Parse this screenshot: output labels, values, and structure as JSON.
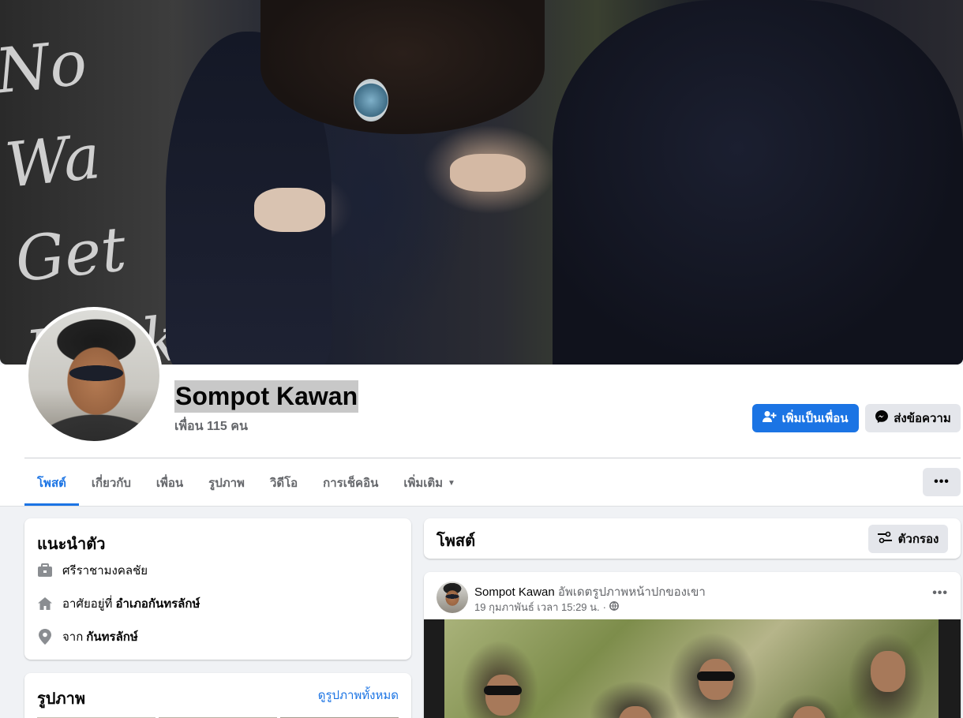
{
  "cover": {
    "graffiti_text": "No Wa\nGet Fuck\nFuck Off"
  },
  "profile": {
    "name": "Sompot Kawan",
    "friends": "เพื่อน 115 คน"
  },
  "actions": {
    "add_friend": "เพิ่มเป็นเพื่อน",
    "message": "ส่งข้อความ",
    "more": "•••"
  },
  "tabs": [
    {
      "label": "โพสต์",
      "active": true
    },
    {
      "label": "เกี่ยวกับ",
      "active": false
    },
    {
      "label": "เพื่อน",
      "active": false
    },
    {
      "label": "รูปภาพ",
      "active": false
    },
    {
      "label": "วิดีโอ",
      "active": false
    },
    {
      "label": "การเช็คอิน",
      "active": false
    },
    {
      "label": "เพิ่มเติม",
      "active": false
    }
  ],
  "intro": {
    "title": "แนะนำตัว",
    "work": "ศรีราชามงคลชัย",
    "lives_prefix": "อาศัยอยู่ที่",
    "lives_place": "อำเภอกันทรลักษ์",
    "from_prefix": "จาก",
    "from_place": "กันทรลักษ์"
  },
  "photos": {
    "title": "รูปภาพ",
    "see_all": "ดูรูปภาพทั้งหมด"
  },
  "posts": {
    "title": "โพสต์",
    "filter": "ตัวกรอง"
  },
  "post": {
    "author": "Sompot Kawan",
    "action": "อัพเดตรูปภาพหน้าปกของเขา",
    "date": "19 กุมภาพันธ์ เวลา 15:29 น.",
    "separator": "·",
    "more": "•••"
  },
  "colors": {
    "accent": "#1b74e4",
    "background": "#f0f2f5",
    "secondary_button": "#e4e6eb",
    "muted_text": "#65676b"
  },
  "icons": {
    "add_friend": "person-plus-icon",
    "message": "messenger-icon",
    "work": "briefcase-icon",
    "home": "house-icon",
    "location": "map-pin-icon",
    "filter": "sliders-icon",
    "privacy": "globe-icon",
    "dropdown": "caret-down-icon"
  }
}
